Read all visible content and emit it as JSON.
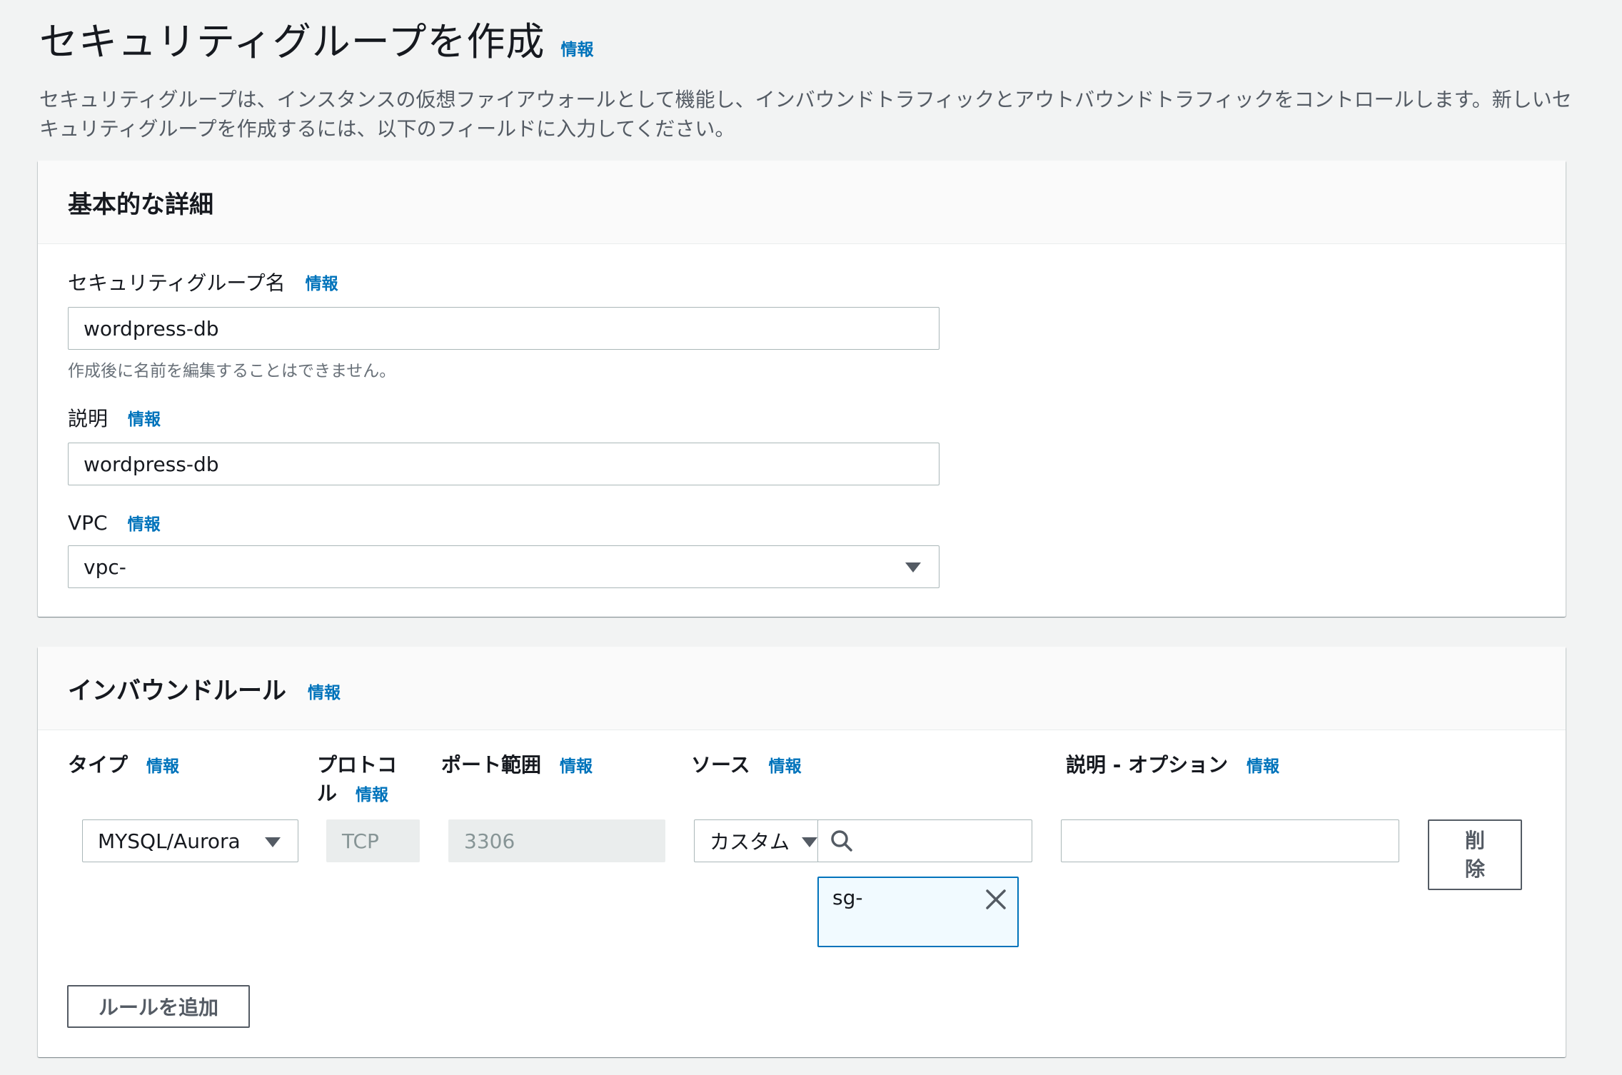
{
  "page": {
    "title": "セキュリティグループを作成",
    "info": "情報",
    "description_line1": "セキュリティグループは、インスタンスの仮想ファイアウォールとして機能し、インバウンドトラフィックとアウトバウンドトラフィックをコントロールします。新しいセ",
    "description_line2": "キュリティグループを作成するには、以下のフィールドに入力してください。"
  },
  "basic": {
    "title": "基本的な詳細",
    "name_label": "セキュリティグループ名",
    "name_value": "wordpress-db",
    "name_hint": "作成後に名前を編集することはできません。",
    "desc_label": "説明",
    "desc_value": "wordpress-db",
    "vpc_label": "VPC",
    "vpc_value": "vpc-"
  },
  "inbound": {
    "title": "インバウンドルール",
    "columns": {
      "type": "タイプ",
      "protocol_line1": "プロトコ",
      "protocol_line2": "ル",
      "port": "ポート範囲",
      "source": "ソース",
      "desc": "説明 - オプション"
    },
    "rule": {
      "type": "MYSQL/Aurora",
      "protocol": "TCP",
      "port": "3306",
      "source_type": "カスタム",
      "source_search": "",
      "source_token": "sg-",
      "description": ""
    },
    "delete_line1": "削",
    "delete_line2": "除",
    "add_rule": "ルールを追加"
  },
  "colors": {
    "link": "#0073bb",
    "background": "#f2f3f3",
    "border": "#aab7b8"
  }
}
